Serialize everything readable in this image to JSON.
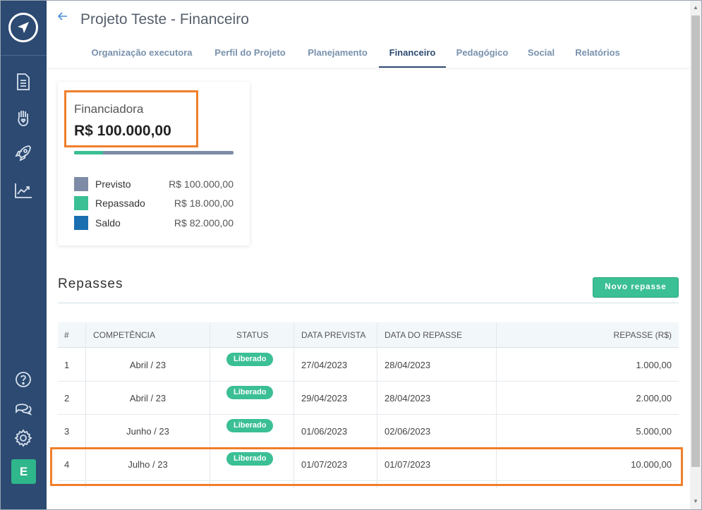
{
  "header": {
    "title": "Projeto Teste - Financeiro",
    "tabs": [
      {
        "label": "Organização executora"
      },
      {
        "label": "Perfil do Projeto"
      },
      {
        "label": "Planejamento"
      },
      {
        "label": "Financeiro"
      },
      {
        "label": "Pedagógico"
      },
      {
        "label": "Social"
      },
      {
        "label": "Relatórios"
      }
    ],
    "active_tab": "Financeiro"
  },
  "sidebar": {
    "icons": [
      "logo-icon",
      "document-icon",
      "hand-heart-icon",
      "rocket-icon",
      "chart-icon",
      "help-icon",
      "chat-icon",
      "gear-icon"
    ],
    "avatar_letter": "E"
  },
  "card": {
    "label": "Financiadora",
    "value": "R$ 100.000,00",
    "progress_fraction": 0.18,
    "legend": [
      {
        "name": "Previsto",
        "value": "R$ 100.000,00",
        "color": "#7d8ba6"
      },
      {
        "name": "Repassado",
        "value": "R$ 18.000,00",
        "color": "#3bbf95"
      },
      {
        "name": "Saldo",
        "value": "R$ 82.000,00",
        "color": "#1a6fb0"
      }
    ]
  },
  "repasses": {
    "title": "Repasses",
    "new_button": "Novo repasse",
    "columns": [
      "#",
      "COMPETÊNCIA",
      "STATUS",
      "DATA PREVISTA",
      "DATA DO REPASSE",
      "REPASSE (R$)"
    ],
    "rows": [
      {
        "num": "1",
        "competencia": "Abril / 23",
        "status": "Liberado",
        "data_prevista": "27/04/2023",
        "data_repasse": "28/04/2023",
        "repasse": "1.000,00"
      },
      {
        "num": "2",
        "competencia": "Abril / 23",
        "status": "Liberado",
        "data_prevista": "29/04/2023",
        "data_repasse": "28/04/2023",
        "repasse": "2.000,00"
      },
      {
        "num": "3",
        "competencia": "Junho / 23",
        "status": "Liberado",
        "data_prevista": "01/06/2023",
        "data_repasse": "02/06/2023",
        "repasse": "5.000,00"
      },
      {
        "num": "4",
        "competencia": "Julho / 23",
        "status": "Liberado",
        "data_prevista": "01/07/2023",
        "data_repasse": "01/07/2023",
        "repasse": "10.000,00"
      }
    ]
  },
  "colors": {
    "sidebar": "#2c4a72",
    "accent_green": "#3bbf95",
    "highlight_orange": "#f07f2b"
  }
}
